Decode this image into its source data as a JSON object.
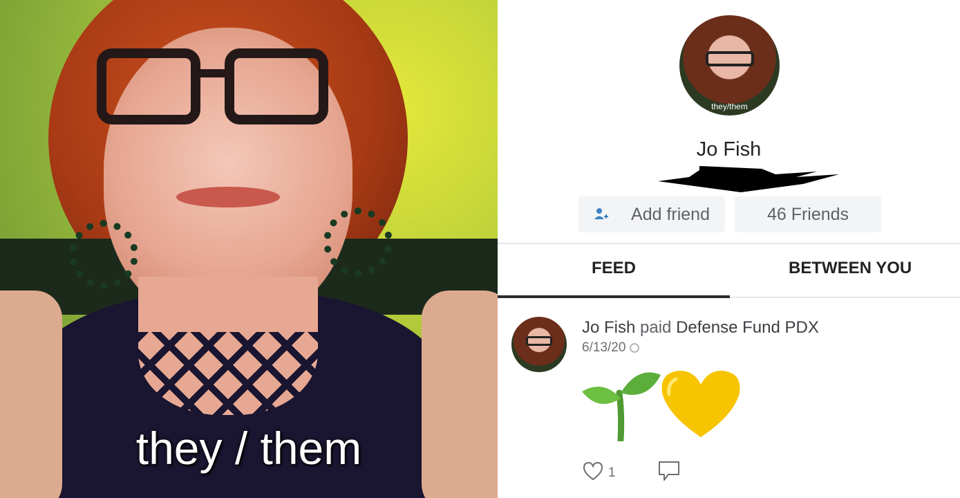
{
  "photo": {
    "caption": "they / them"
  },
  "profile": {
    "avatar_tag": "they/them",
    "name": "Jo Fish"
  },
  "actions": {
    "add_friend_label": "Add friend",
    "friends_label": "46 Friends"
  },
  "tabs": [
    {
      "label": "FEED",
      "active": true
    },
    {
      "label": "BETWEEN YOU",
      "active": false
    }
  ],
  "post": {
    "actor": "Jo Fish",
    "verb": "paid",
    "target": "Defense Fund PDX",
    "date": "6/13/20",
    "visibility_icon": "globe-icon",
    "emojis": [
      "seedling",
      "yellow-heart"
    ],
    "likes": "1"
  },
  "colors": {
    "text_primary": "#222222",
    "text_muted": "#5f6166",
    "button_bg": "#f3f4f6",
    "divider": "#e4e5e8",
    "heart": "#f6c400",
    "seedling": "#5cae3a"
  }
}
